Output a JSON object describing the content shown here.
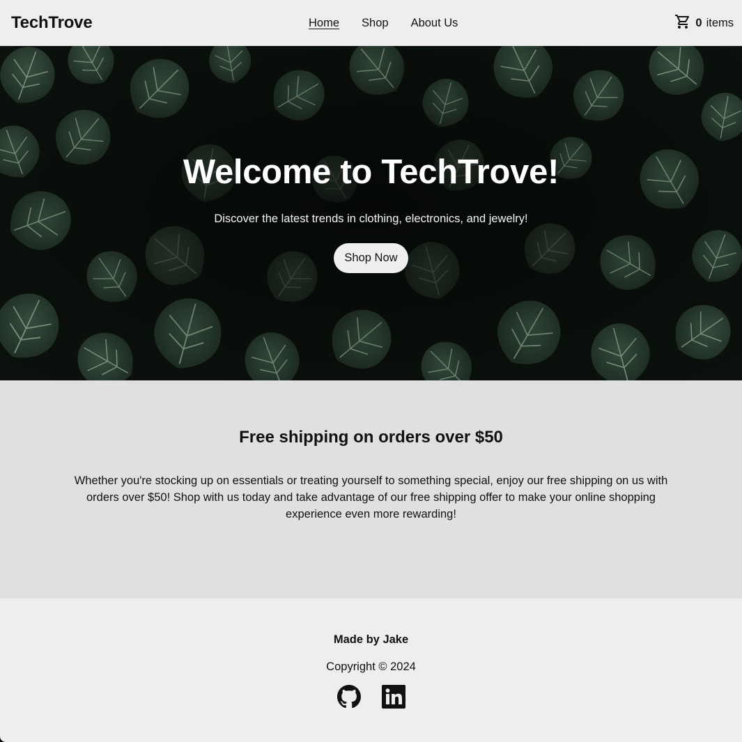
{
  "header": {
    "brand": "TechTrove",
    "nav": [
      {
        "label": "Home"
      },
      {
        "label": "Shop"
      },
      {
        "label": "About Us"
      }
    ],
    "cart": {
      "count": "0",
      "label": "items",
      "icon": "cart-icon"
    }
  },
  "hero": {
    "title": "Welcome to TechTrove!",
    "subtitle": "Discover the latest trends in clothing, electronics, and jewelry!",
    "button": "Shop Now"
  },
  "shipping": {
    "title": "Free shipping on orders over $50",
    "text": "Whether you're stocking up on essentials or treating yourself to something special, enjoy our free shipping on us with orders over $50! Shop with us today and take advantage of our free shipping offer to make your online shopping experience even more rewarding!"
  },
  "footer": {
    "made_by": "Made by Jake",
    "copyright": "Copyright © 2024",
    "socials": [
      {
        "icon": "github-icon"
      },
      {
        "icon": "linkedin-icon"
      }
    ]
  },
  "colors": {
    "header_bg": "#eeeeee",
    "shipping_bg": "#e0e0e0",
    "footer_bg": "#eeeeee",
    "text": "#111111"
  }
}
